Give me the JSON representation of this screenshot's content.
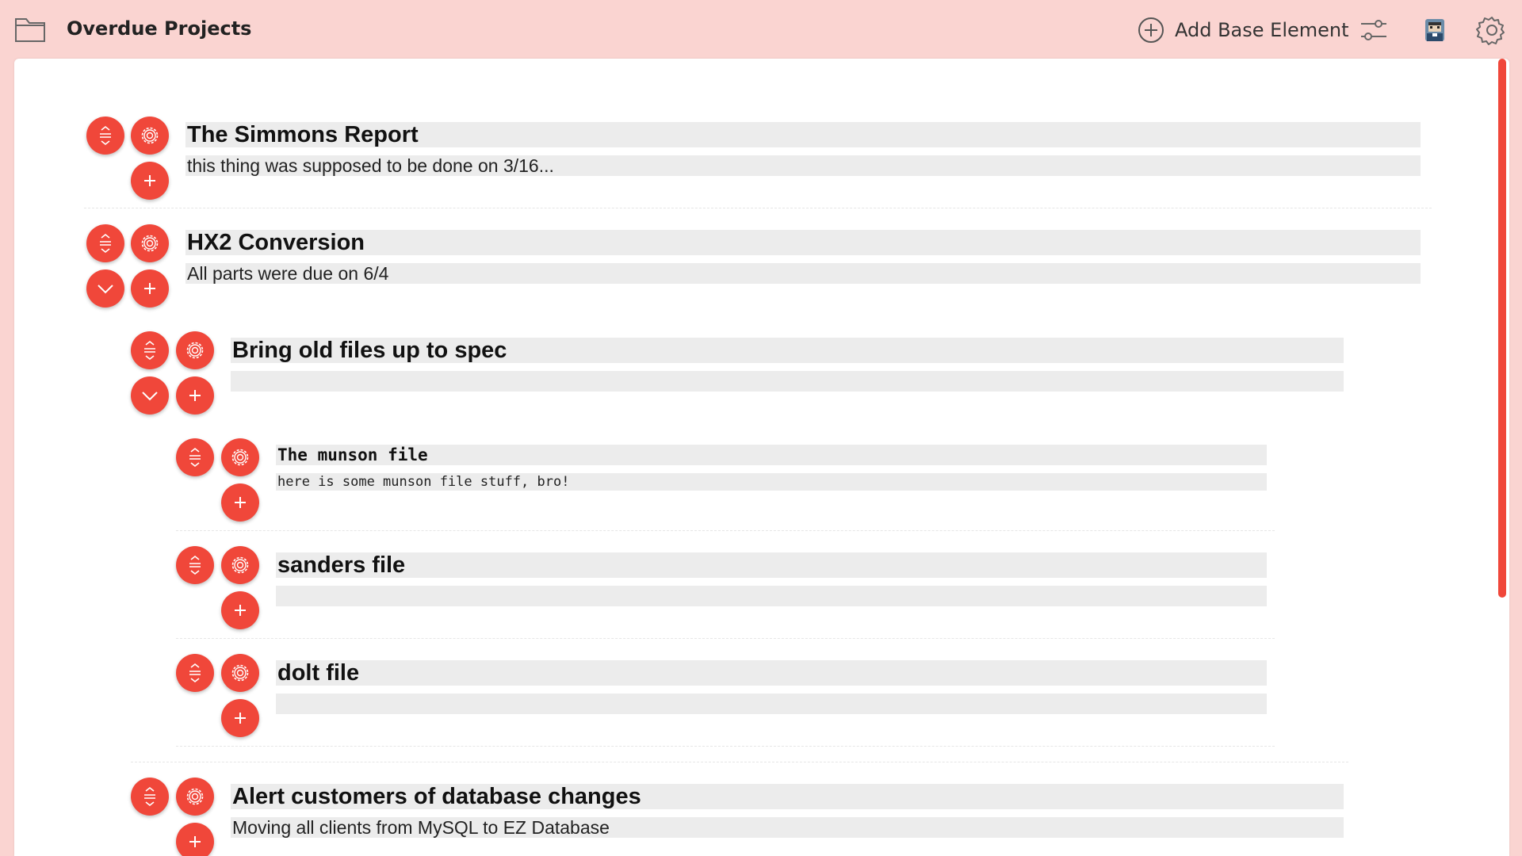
{
  "header": {
    "title": "Overdue Projects",
    "add_base_label": "Add Base Element"
  },
  "colors": {
    "accent": "#f0473a",
    "background": "#fad4d1",
    "field": "#ececec"
  },
  "icons": {
    "folder": "folder-icon",
    "add": "plus-circle-icon",
    "filters": "sliders-icon",
    "avatar": "user-avatar",
    "settings": "gear-icon"
  },
  "elements": [
    {
      "title": "The Simmons Report",
      "description": "this thing was supposed to be done on 3/16..."
    },
    {
      "title": "HX2 Conversion",
      "description": "All parts were due on 6/4"
    },
    {
      "title": "Bring old files up to spec",
      "description": ""
    },
    {
      "title": "The munson file",
      "description": "here is some munson file stuff, bro!"
    },
    {
      "title": "sanders file",
      "description": ""
    },
    {
      "title": "dolt file",
      "description": ""
    },
    {
      "title": "Alert customers of database changes",
      "description": "Moving all clients from MySQL to EZ Database"
    }
  ]
}
